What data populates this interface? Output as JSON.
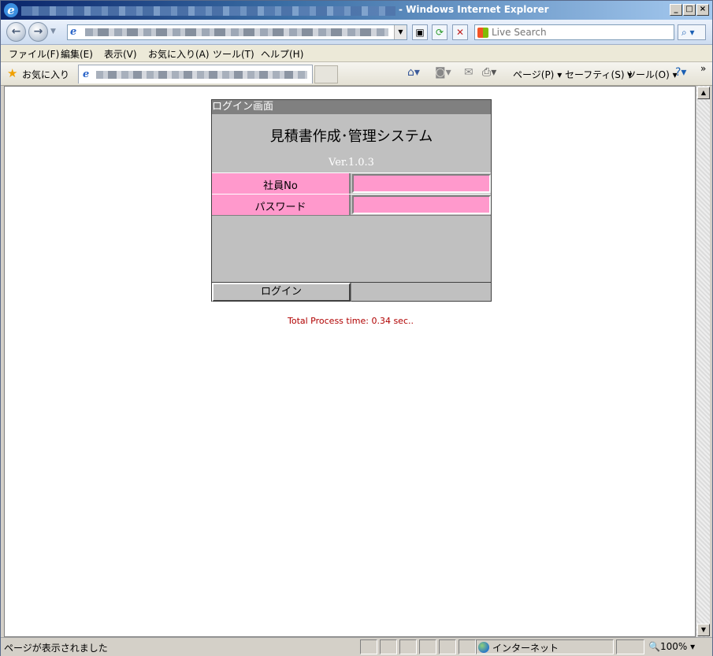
{
  "window": {
    "title": "- Windows Internet Explorer",
    "controls": {
      "minimize": "_",
      "maximize": "□",
      "close": "×"
    }
  },
  "toolbar": {
    "back_icon": "back-arrow-icon",
    "forward_icon": "forward-arrow-icon",
    "search_placeholder": "Live Search",
    "search_button": "⌕ ▾"
  },
  "menu": {
    "items": [
      "ファイル(F)",
      "編集(E)",
      "表示(V)",
      "お気に入り(A)",
      "ツール(T)",
      "ヘルプ(H)"
    ]
  },
  "command_bar": {
    "favorites": "お気に入り",
    "page": "ページ(P)",
    "safety": "セーフティ(S)",
    "tools": "ツール(O)",
    "more": "»"
  },
  "login": {
    "header": "ログイン画面",
    "app_title": "見積書作成･管理システム",
    "version": "Ver.1.0.3",
    "employee_label": "社員No",
    "password_label": "パスワード",
    "login_button": "ログイン"
  },
  "process_time": "Total Process time: 0.34 sec..",
  "status": {
    "message": "ページが表示されました",
    "zone": "インターネット",
    "zoom": "100%"
  },
  "colors": {
    "field_bg": "#ff99cc",
    "panel_bg": "#c0c0c0",
    "header_bg": "#808080",
    "process_time": "#b00000"
  }
}
